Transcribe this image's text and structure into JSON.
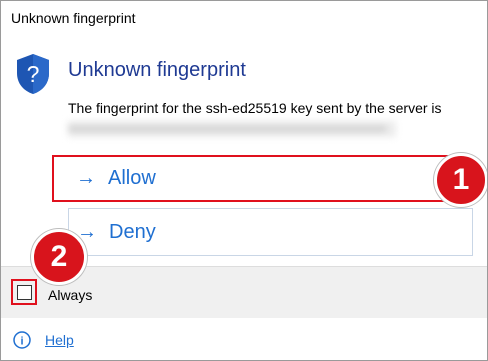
{
  "window": {
    "title": "Unknown fingerprint"
  },
  "dialog": {
    "icon": "shield-question-icon",
    "heading": "Unknown fingerprint",
    "message": "The fingerprint for the ssh-ed25519 key sent by the server is",
    "fingerprint_redacted": "xxxxxxxxxxxxxxxxxxxxxxxxxxxxxxxxxxxxxxxxxxxxxxxxxxxxx"
  },
  "commands": {
    "arrow": "→",
    "allow_label": "Allow",
    "deny_label": "Deny"
  },
  "options": {
    "always_label": "Always",
    "always_checked": false
  },
  "footer": {
    "help_label": "Help",
    "help_icon": "help-circle-icon"
  },
  "annotations": {
    "badge_1": "1",
    "badge_2": "2"
  },
  "colors": {
    "heading": "#1f3a93",
    "link": "#1f6fd1",
    "highlight": "#e0101d",
    "badge": "#d8141c",
    "footer_bg": "#f0f0f0"
  }
}
